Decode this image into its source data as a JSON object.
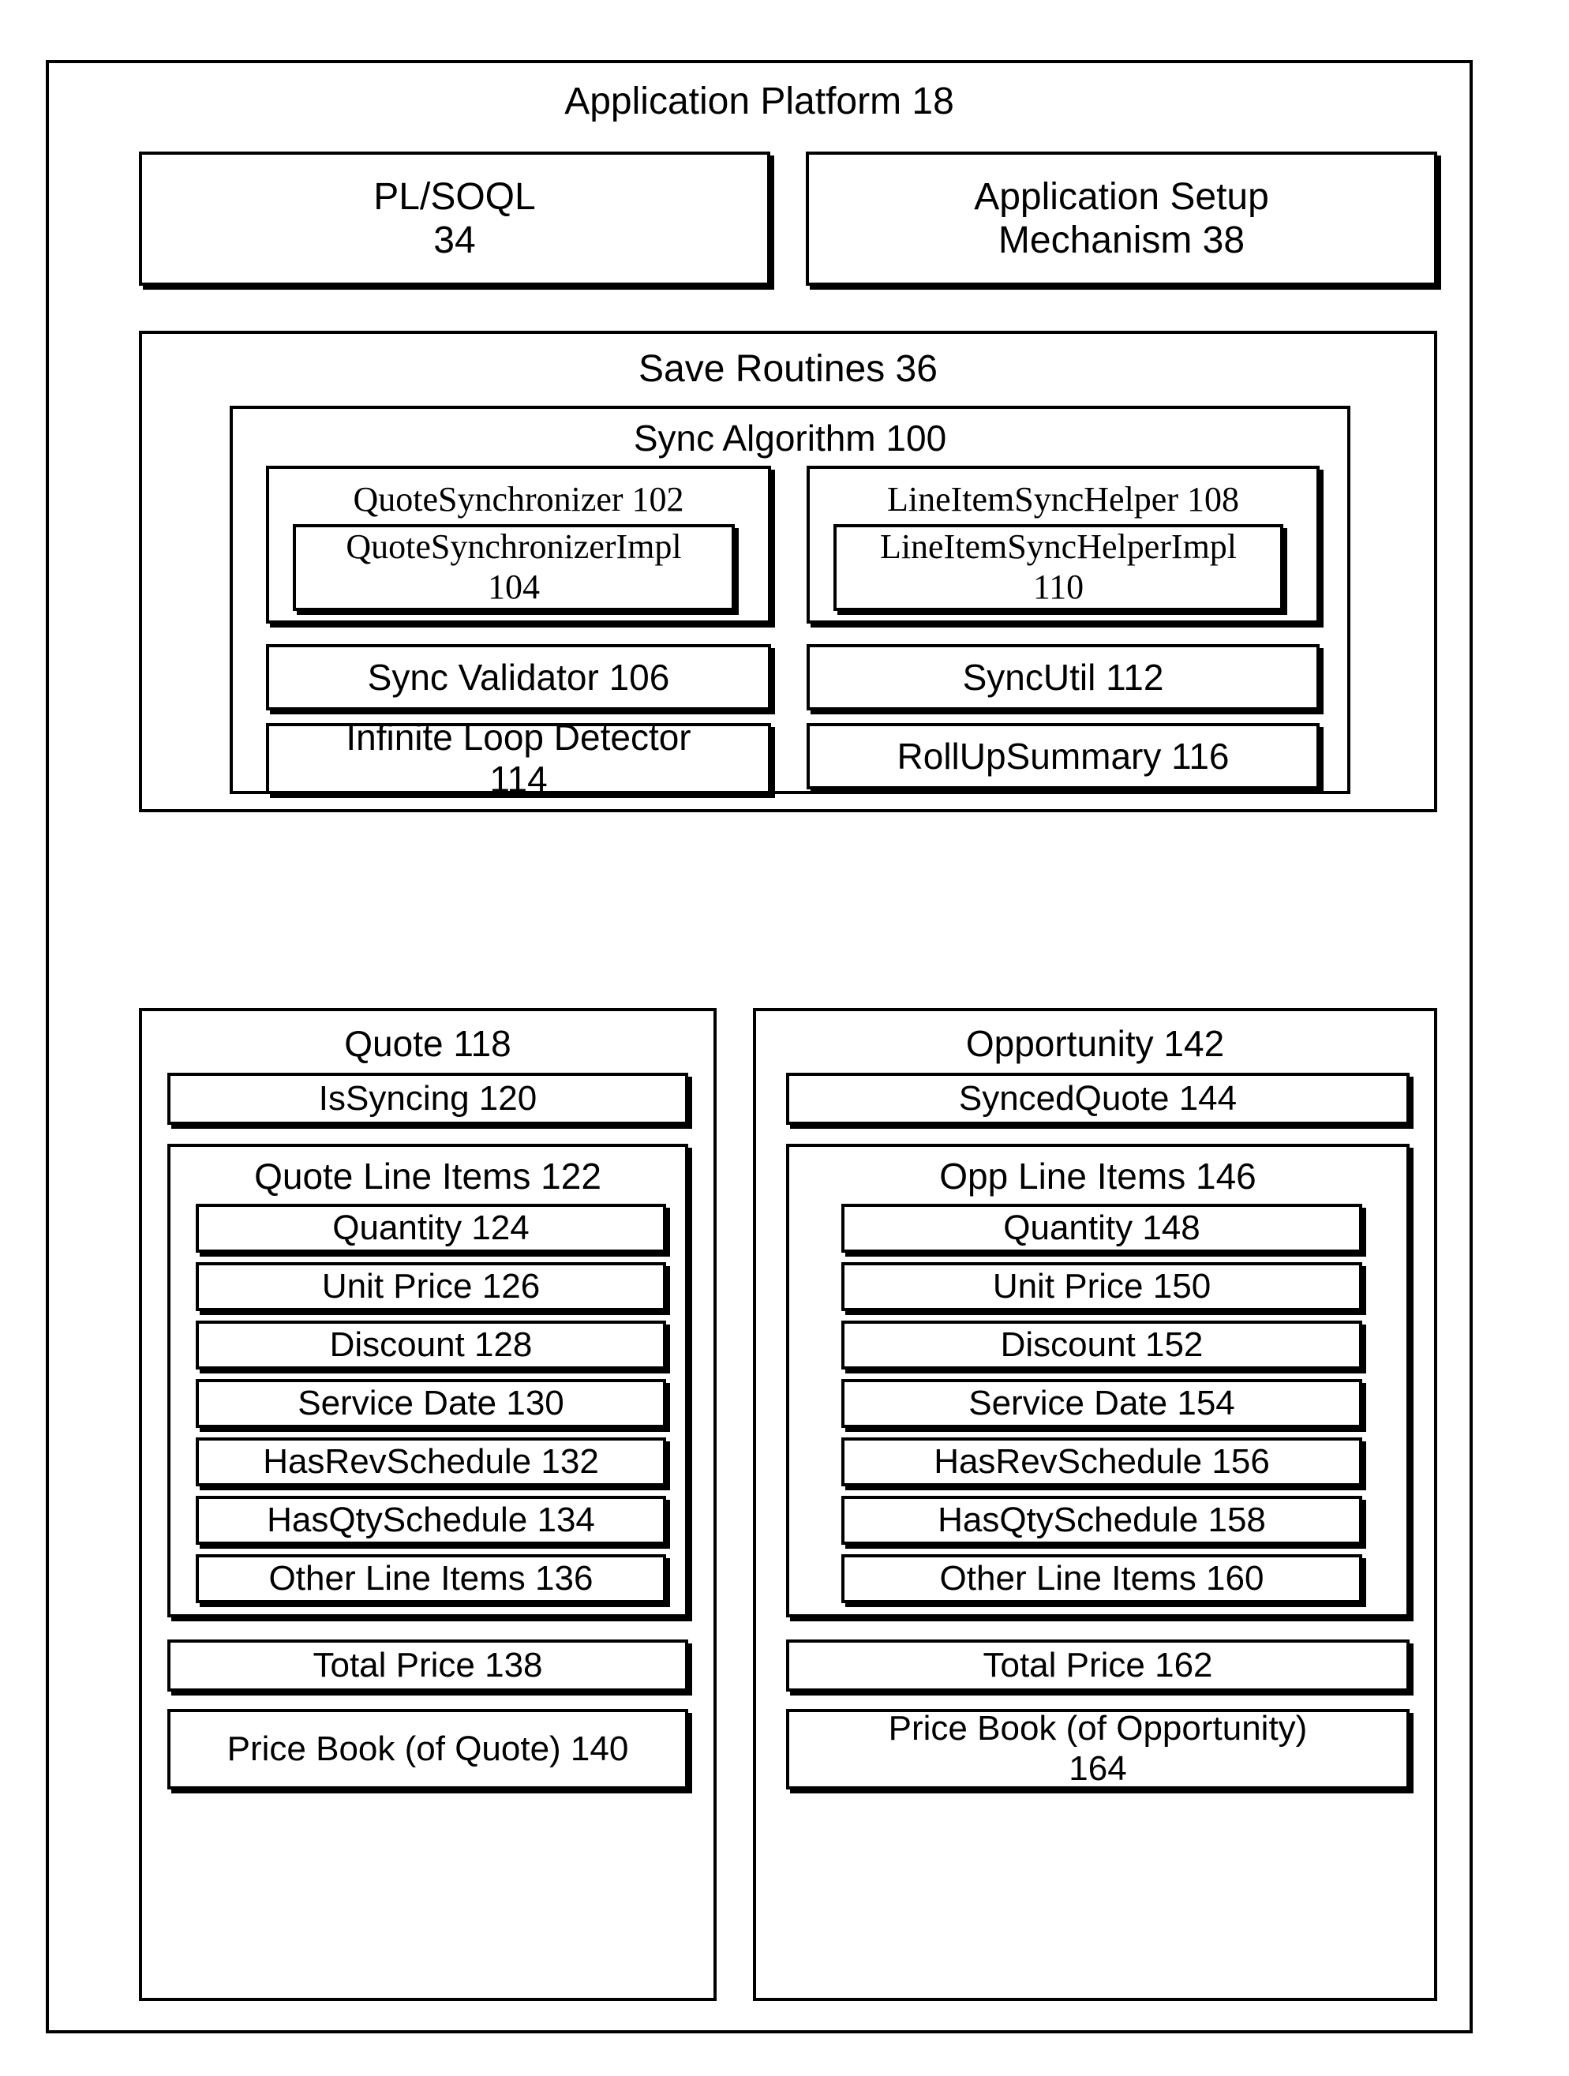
{
  "figure": {
    "platform": {
      "title": "Application Platform 18"
    },
    "top_row": [
      {
        "name": "pl-soql",
        "label": "PL/SOQL\n34",
        "line1": "PL/SOQL",
        "line2": "34"
      },
      {
        "name": "application-setup-mechanism",
        "label": "Application Setup Mechanism 38",
        "line1": "Application Setup",
        "line2": "Mechanism 38"
      }
    ],
    "save_routines": {
      "title": "Save Routines 36",
      "sync_algorithm": {
        "title": "Sync Algorithm 100",
        "left_column": [
          {
            "name": "quote-synchronizer",
            "title": "QuoteSynchronizer 102",
            "child": {
              "name": "quote-synchronizer-impl",
              "line1": "QuoteSynchronizerImpl",
              "line2": "104"
            }
          },
          {
            "name": "sync-validator",
            "label": "Sync Validator 106"
          },
          {
            "name": "infinite-loop-detector",
            "line1": "Infinite Loop Detector",
            "line2": "114"
          }
        ],
        "right_column": [
          {
            "name": "line-item-sync-helper",
            "title": "LineItemSyncHelper 108",
            "child": {
              "name": "line-item-sync-helper-impl",
              "line1": "LineItemSyncHelperImpl",
              "line2": "110"
            }
          },
          {
            "name": "sync-util",
            "label": "SyncUtil 112"
          },
          {
            "name": "roll-up-summary",
            "label": "RollUpSummary 116"
          }
        ]
      }
    },
    "quote": {
      "title": "Quote 118",
      "flag": "IsSyncing 120",
      "line_items": {
        "title": "Quote Line Items 122",
        "fields": [
          "Quantity 124",
          "Unit Price 126",
          "Discount 128",
          "Service Date 130",
          "HasRevSchedule 132",
          "HasQtySchedule 134",
          "Other Line Items 136"
        ]
      },
      "total_price": "Total Price 138",
      "price_book": {
        "line1": "Price Book (of Quote) 140",
        "line2": ""
      }
    },
    "opportunity": {
      "title": "Opportunity 142",
      "flag": "SyncedQuote 144",
      "line_items": {
        "title": "Opp Line Items 146",
        "fields": [
          "Quantity 148",
          "Unit Price 150",
          "Discount 152",
          "Service Date 154",
          "HasRevSchedule 156",
          "HasQtySchedule 158",
          "Other Line Items 160"
        ]
      },
      "total_price": "Total Price 162",
      "price_book": {
        "line1": "Price Book (of Opportunity)",
        "line2": "164"
      }
    },
    "colors": {
      "ink": "#000000",
      "paper": "#ffffff"
    }
  }
}
